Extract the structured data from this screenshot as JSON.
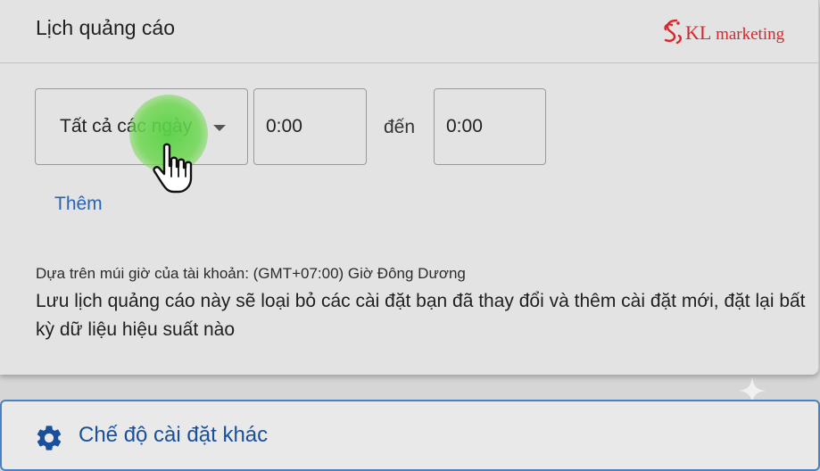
{
  "card": {
    "title": "Lịch quảng cáo",
    "logo": {
      "mark": "KL",
      "text": "marketing"
    }
  },
  "schedule": {
    "day_selector": {
      "value": "Tất cả các ngày",
      "icon": "dropdown-arrow-icon"
    },
    "start_time": "0:00",
    "to_label": "đến",
    "end_time": "0:00",
    "add_label": "Thêm"
  },
  "timezone_note": "Dựa trên múi giờ của tài khoản: (GMT+07:00) Giờ Đông Dương",
  "warning_text": "Lưu lịch quảng cáo này sẽ loại bỏ các cài đặt bạn đã thay đổi và thêm cài đặt mới, đặt lại bất kỳ dữ liệu hiệu suất nào",
  "other_settings": {
    "label": "Chế độ cài đặt khác",
    "icon": "gear-icon"
  },
  "colors": {
    "link_blue": "#2a63b5",
    "section_blue": "#1a4f9c",
    "logo_red": "#d8262b",
    "click_highlight": "#58d246"
  }
}
